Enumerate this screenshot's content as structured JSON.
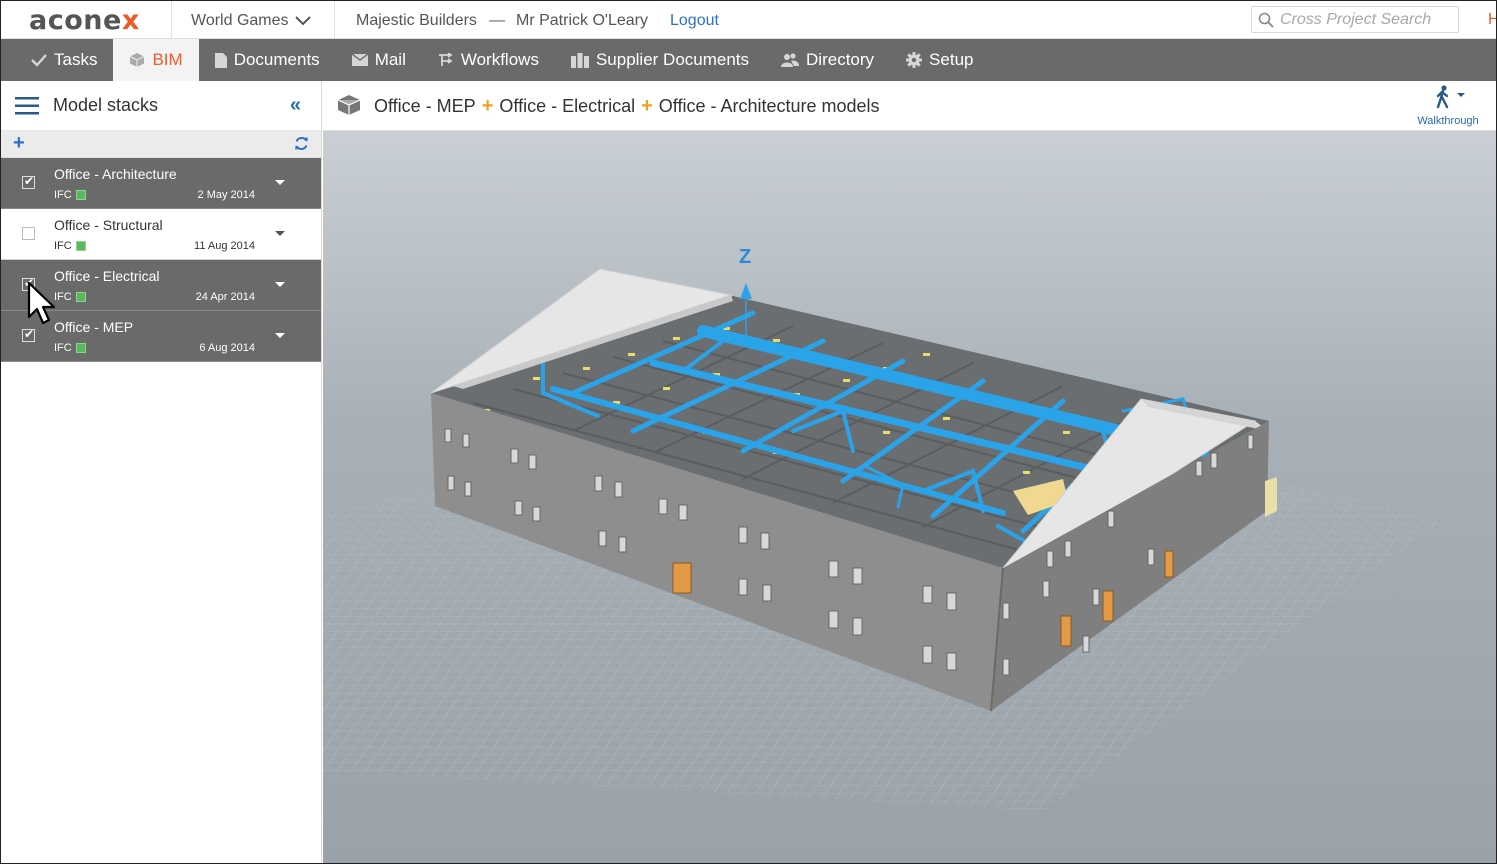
{
  "header": {
    "logo_text": "acone",
    "logo_accent": "x",
    "project": "World Games",
    "organization": "Majestic Builders",
    "separator": "—",
    "user": "Mr Patrick O'Leary",
    "logout": "Logout",
    "search_placeholder": "Cross Project Search",
    "help_text": "H"
  },
  "nav": {
    "items": [
      {
        "label": "Tasks",
        "icon": "check-icon"
      },
      {
        "label": "BIM",
        "icon": "cube-icon",
        "active": true
      },
      {
        "label": "Documents",
        "icon": "document-icon"
      },
      {
        "label": "Mail",
        "icon": "mail-icon"
      },
      {
        "label": "Workflows",
        "icon": "workflow-icon"
      },
      {
        "label": "Supplier Documents",
        "icon": "supplier-icon"
      },
      {
        "label": "Directory",
        "icon": "people-icon"
      },
      {
        "label": "Setup",
        "icon": "gear-icon"
      }
    ]
  },
  "sidebar": {
    "title": "Model stacks",
    "items": [
      {
        "name": "Office - Architecture",
        "type": "IFC",
        "date": "2 May 2014",
        "checked": true
      },
      {
        "name": "Office - Structural",
        "type": "IFC",
        "date": "11 Aug 2014",
        "checked": false
      },
      {
        "name": "Office - Electrical",
        "type": "IFC",
        "date": "24 Apr 2014",
        "checked": true
      },
      {
        "name": "Office - MEP",
        "type": "IFC",
        "date": "6 Aug 2014",
        "checked": true
      }
    ]
  },
  "main": {
    "breadcrumb": [
      "Office - MEP",
      "Office - Electrical",
      "Office - Architecture models"
    ],
    "breadcrumb_join": "+",
    "walkthrough_label": "Walkthrough",
    "axis_label": "Z"
  },
  "colors": {
    "accent": "#f05a28",
    "nav_bg": "#6a6a6a",
    "link": "#2a73c7",
    "duct": "#2aa3e8",
    "building": "#8c8c8c"
  }
}
